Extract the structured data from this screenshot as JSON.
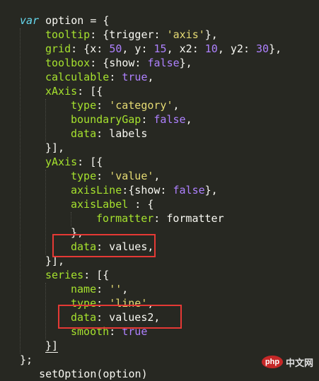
{
  "code": {
    "l01": {
      "a": "var",
      "b": " option = {"
    },
    "l02": {
      "k": "tooltip",
      "r": ": {trigger: ",
      "s": "'axis'",
      "e": "},"
    },
    "l03": {
      "k": "grid",
      "r1": ": {x: ",
      "n1": "50",
      "r2": ", y: ",
      "n2": "15",
      "r3": ", x2: ",
      "n3": "10",
      "r4": ", y2: ",
      "n4": "30",
      "e": "},"
    },
    "l04": {
      "k": "toolbox",
      "r": ": {show: ",
      "v": "false",
      "e": "},"
    },
    "l05": {
      "k": "calculable",
      "r": ": ",
      "v": "true",
      "e": ","
    },
    "l06": {
      "k": "xAxis",
      "r": ": [{"
    },
    "l07": {
      "k": "type",
      "r": ": ",
      "s": "'category'",
      "e": ","
    },
    "l08": {
      "k": "boundaryGap",
      "r": ": ",
      "v": "false",
      "e": ","
    },
    "l09": {
      "k": "data",
      "r": ": labels"
    },
    "l10": {
      "t": "}],"
    },
    "l11": {
      "k": "yAxis",
      "r": ": [{"
    },
    "l12": {
      "k": "type",
      "r": ": ",
      "s": "'value'",
      "e": ","
    },
    "l13": {
      "k": "axisLine",
      "r": ":{show: ",
      "v": "false",
      "e": "},"
    },
    "l14": {
      "k": "axisLabel",
      "r": " : {"
    },
    "l15": {
      "k": "formatter",
      "r": ": formatter"
    },
    "l16": {
      "t": "},"
    },
    "l17": {
      "k": "data",
      "r": ": values,"
    },
    "l18": {
      "t": "}],"
    },
    "l19": {
      "k": "series",
      "r": ": [{"
    },
    "l20": {
      "k": "name",
      "r": ": ",
      "s": "''",
      "e": ","
    },
    "l21": {
      "k": "type",
      "r": ": ",
      "s": "'line'",
      "e": ","
    },
    "l22": {
      "k": "data",
      "r": ": values2,"
    },
    "l23": {
      "k": "smooth",
      "r": ": ",
      "v": "true"
    },
    "l24": {
      "t": "}]"
    },
    "l25": {
      "t": "};"
    },
    "l26": {
      "t": "   setOption(option)"
    }
  },
  "watermark": {
    "logo": "php",
    "text": "中文网"
  },
  "colors": {
    "background": "#272822",
    "highlight_box": "#e53935",
    "keyword": "#66d9ef",
    "property": "#a6e22e",
    "string": "#e6db74",
    "number": "#ae81ff"
  }
}
